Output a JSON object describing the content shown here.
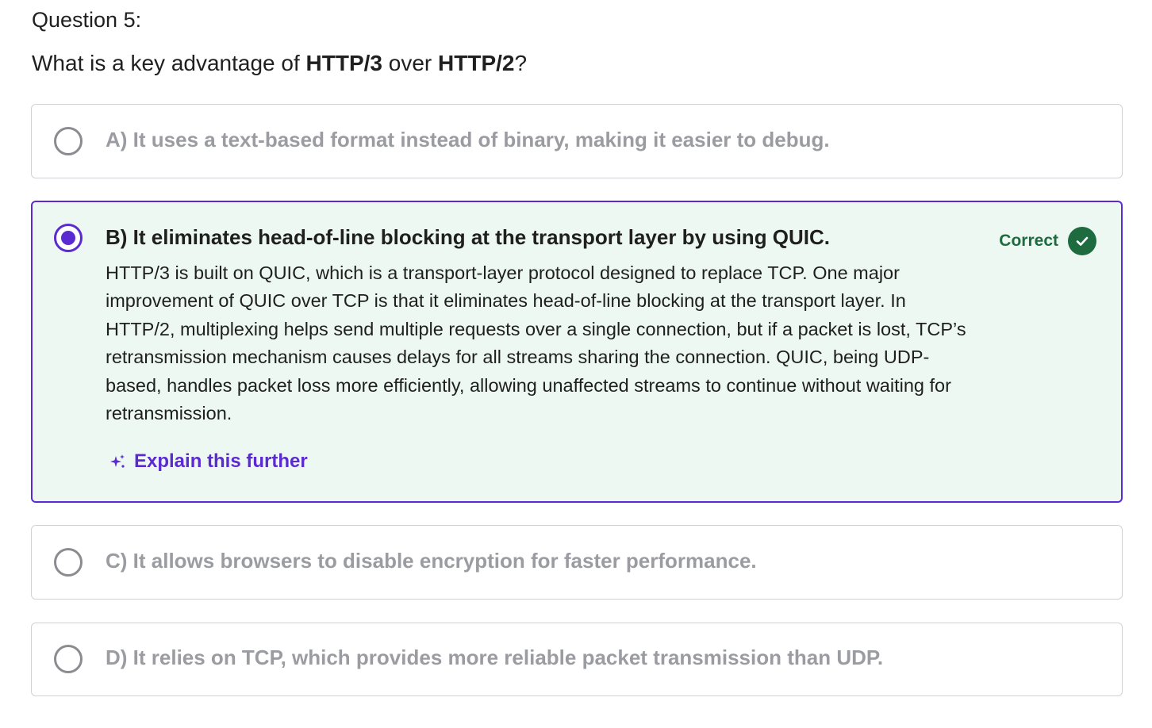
{
  "question": {
    "number_label": "Question 5:",
    "text_prefix": "What is a key advantage of ",
    "term_1": "HTTP/3",
    "text_middle": " over ",
    "term_2": "HTTP/2",
    "text_suffix": "?"
  },
  "options": {
    "a": {
      "label": "A) It uses a text-based format instead of binary, making it easier to debug.",
      "selected": false
    },
    "b": {
      "label": "B) It eliminates head-of-line blocking at the transport layer by using QUIC.",
      "selected": true,
      "status": "Correct",
      "feedback": "HTTP/3 is built on QUIC, which is a transport-layer protocol designed to replace TCP. One major improvement of QUIC over TCP is that it eliminates head-of-line blocking at the transport layer. In HTTP/2, multiplexing helps send multiple requests over a single connection, but if a packet is lost, TCP’s retransmission mechanism causes delays for all streams sharing the connection. QUIC, being UDP-based, handles packet loss more efficiently, allowing unaffected streams to continue without waiting for retransmission.",
      "explain_link": "Explain this further"
    },
    "c": {
      "label": "C) It allows browsers to disable encryption for faster performance.",
      "selected": false
    },
    "d": {
      "label": "D) It relies on TCP, which provides more reliable packet transmission than UDP.",
      "selected": false
    }
  },
  "icons": {
    "radio_unselected": "radio-empty-icon",
    "radio_selected": "radio-filled-icon",
    "correct": "check-circle-icon",
    "explain": "sparkle-icon"
  },
  "colors": {
    "accent": "#5b2bd1",
    "correct_green": "#1e6b3f",
    "correct_bg": "#edf8f2",
    "muted_text": "#9b9ca1",
    "border": "#d1d2d6"
  }
}
